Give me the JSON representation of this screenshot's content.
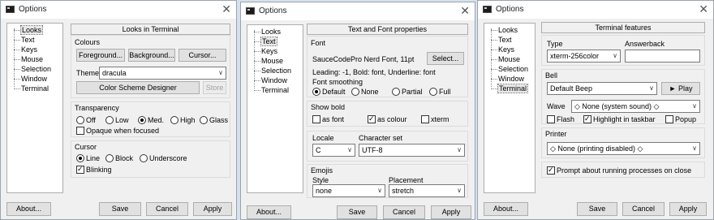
{
  "window1": {
    "title": "Options",
    "tree": [
      "Looks",
      "Text",
      "Keys",
      "Mouse",
      "Selection",
      "Window",
      "Terminal"
    ],
    "panel_title": "Looks in Terminal",
    "colours": {
      "label": "Colours",
      "foreground": "Foreground...",
      "background": "Background...",
      "cursor": "Cursor...",
      "theme_label": "Theme",
      "theme_value": "dracula",
      "designer": "Color Scheme Designer",
      "store": "Store"
    },
    "transparency": {
      "label": "Transparency",
      "options": [
        "Off",
        "Low",
        "Med.",
        "High",
        "Glass"
      ],
      "selected": "Med.",
      "opaque": "Opaque when focused"
    },
    "cursor": {
      "label": "Cursor",
      "options": [
        "Line",
        "Block",
        "Underscore"
      ],
      "selected": "Line",
      "blinking": "Blinking"
    },
    "buttons": {
      "about": "About...",
      "save": "Save",
      "cancel": "Cancel",
      "apply": "Apply"
    }
  },
  "window2": {
    "title": "Options",
    "tree": [
      "Looks",
      "Text",
      "Keys",
      "Mouse",
      "Selection",
      "Window",
      "Terminal"
    ],
    "panel_title": "Text and Font properties",
    "font": {
      "label": "Font",
      "name": "SauceCodePro Nerd Font, 11pt",
      "select": "Select...",
      "leading": "Leading: -1, Bold: font, Underline: font",
      "smoothing_label": "Font smoothing",
      "smoothing_options": [
        "Default",
        "None",
        "Partial",
        "Full"
      ],
      "smoothing_selected": "Default"
    },
    "show_bold": {
      "label": "Show bold",
      "as_font": "as font",
      "as_colour": "as colour",
      "xterm": "xterm"
    },
    "locale": {
      "label": "Locale",
      "value": "C"
    },
    "charset": {
      "label": "Character set",
      "value": "UTF-8"
    },
    "emojis": {
      "label": "Emojis",
      "style_label": "Style",
      "style_value": "none",
      "placement_label": "Placement",
      "placement_value": "stretch"
    },
    "buttons": {
      "about": "About...",
      "save": "Save",
      "cancel": "Cancel",
      "apply": "Apply"
    }
  },
  "window3": {
    "title": "Options",
    "tree": [
      "Looks",
      "Text",
      "Keys",
      "Mouse",
      "Selection",
      "Window",
      "Terminal"
    ],
    "panel_title": "Terminal features",
    "type": {
      "label": "Type",
      "value": "xterm-256color"
    },
    "answerback": {
      "label": "Answerback",
      "value": ""
    },
    "bell": {
      "label": "Bell",
      "value": "Default Beep",
      "play": "► Play",
      "wave_label": "Wave",
      "wave_value": "◇ None (system sound) ◇",
      "flash": "Flash",
      "highlight": "Highlight in taskbar",
      "popup": "Popup"
    },
    "printer": {
      "label": "Printer",
      "value": "◇ None (printing disabled) ◇"
    },
    "prompt": "Prompt about running processes on close",
    "buttons": {
      "about": "About...",
      "save": "Save",
      "cancel": "Cancel",
      "apply": "Apply"
    }
  }
}
